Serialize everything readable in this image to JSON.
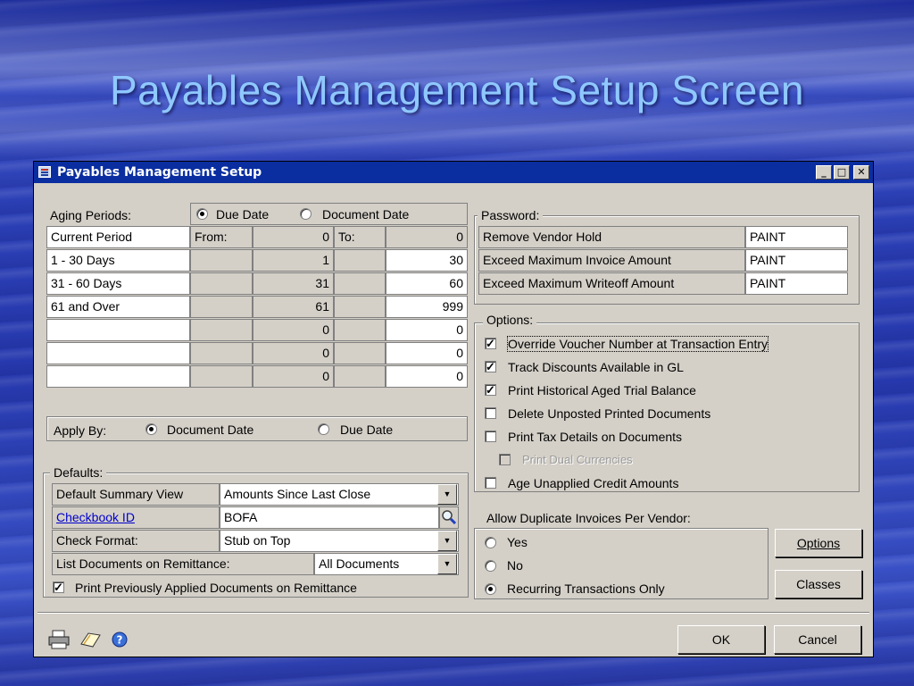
{
  "slide": {
    "title": "Payables Management Setup Screen"
  },
  "window": {
    "title": "Payables Management Setup",
    "controls": {
      "minimize": "_",
      "maximize": "□",
      "close": "✕"
    }
  },
  "aging": {
    "label": "Aging Periods:",
    "radio_due_date": "Due Date",
    "radio_document_date": "Document Date",
    "selected": "Due Date",
    "from_label": "From:",
    "to_label": "To:",
    "rows": [
      {
        "name": "Current Period",
        "from": "0",
        "to": "0"
      },
      {
        "name": "1 - 30 Days",
        "from": "1",
        "to": "30"
      },
      {
        "name": "31 - 60 Days",
        "from": "31",
        "to": "60"
      },
      {
        "name": "61 and Over",
        "from": "61",
        "to": "999"
      },
      {
        "name": "",
        "from": "0",
        "to": "0"
      },
      {
        "name": "",
        "from": "0",
        "to": "0"
      },
      {
        "name": "",
        "from": "0",
        "to": "0"
      }
    ]
  },
  "apply_by": {
    "label": "Apply By:",
    "document_date": "Document Date",
    "due_date": "Due Date",
    "selected": "Document Date"
  },
  "defaults": {
    "label": "Defaults:",
    "summary_view_label": "Default Summary View",
    "summary_view_value": "Amounts Since Last Close",
    "checkbook_label": "Checkbook ID",
    "checkbook_value": "BOFA",
    "check_format_label": "Check Format:",
    "check_format_value": "Stub on Top",
    "list_docs_label": "List Documents on Remittance:",
    "list_docs_value": "All Documents",
    "print_prev_label": "Print Previously Applied Documents on Remittance",
    "print_prev_checked": true
  },
  "password": {
    "label": "Password:",
    "rows": [
      {
        "label": "Remove Vendor Hold",
        "value": "PAINT"
      },
      {
        "label": "Exceed Maximum Invoice Amount",
        "value": "PAINT"
      },
      {
        "label": "Exceed Maximum Writeoff Amount",
        "value": "PAINT"
      }
    ]
  },
  "options": {
    "label": "Options:",
    "items": [
      {
        "label": "Override Voucher Number at Transaction Entry",
        "checked": true
      },
      {
        "label": "Track Discounts  Available in GL",
        "checked": true
      },
      {
        "label": "Print Historical  Aged Trial Balance",
        "checked": true
      },
      {
        "label": "Delete Unposted Printed Documents",
        "checked": false
      },
      {
        "label": "Print Tax Details on Documents",
        "checked": false
      },
      {
        "label": "Print Dual Currencies",
        "checked": false,
        "disabled": true
      },
      {
        "label": "Age Unapplied Credit Amounts",
        "checked": false
      }
    ]
  },
  "duplicates": {
    "label": "Allow Duplicate Invoices Per Vendor:",
    "yes": "Yes",
    "no": "No",
    "recurring": "Recurring Transactions Only",
    "selected": "Recurring Transactions Only"
  },
  "buttons": {
    "options": "Options",
    "classes": "Classes",
    "ok": "OK",
    "cancel": "Cancel"
  },
  "colors": {
    "titlebar": "#0a2ea0",
    "dialog_face": "#d4d0c8",
    "slide_title": "#8fc8ff",
    "link": "#0000cc"
  },
  "icons": [
    "printer-icon",
    "note-icon",
    "help-icon",
    "search-icon",
    "dropdown-arrow-icon"
  ]
}
